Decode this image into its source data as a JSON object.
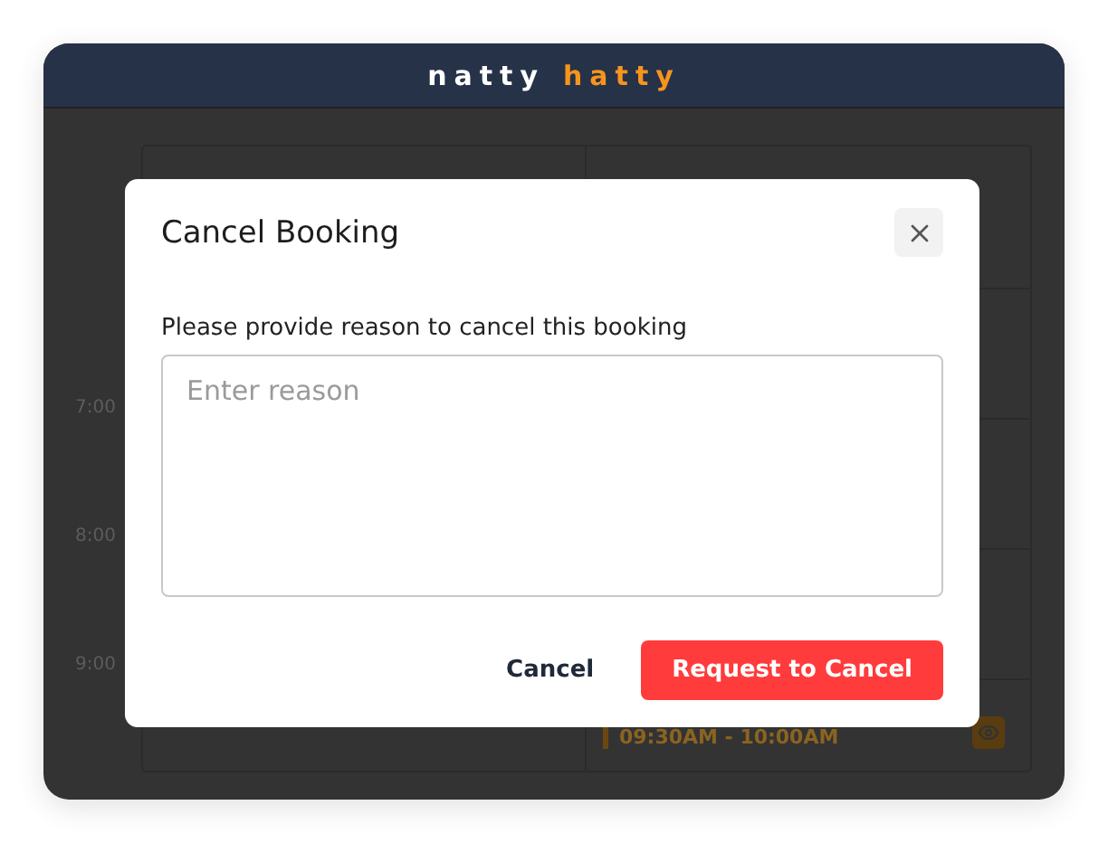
{
  "header": {
    "brand": [
      {
        "text": "natty",
        "color": "#ffffff"
      },
      {
        "text": "hatty",
        "color": "#f7941d"
      }
    ]
  },
  "calendar": {
    "times": [
      "7:00",
      "8:00",
      "9:00"
    ],
    "booking": {
      "time": "09:30AM - 10:00AM"
    }
  },
  "dialog": {
    "title": "Cancel Booking",
    "label": "Please provide reason to cancel this booking",
    "reason": {
      "placeholder": "Enter reason"
    },
    "buttons": [
      {
        "label": "Cancel",
        "kind": "secondary"
      },
      {
        "label": "Request to Cancel",
        "kind": "primary"
      }
    ]
  }
}
